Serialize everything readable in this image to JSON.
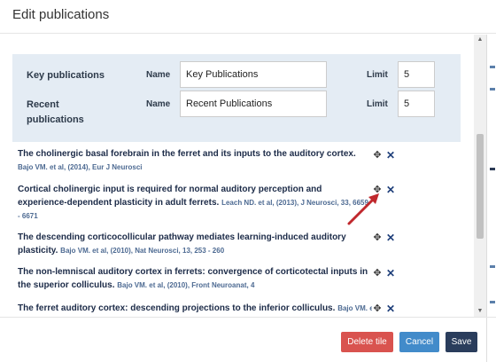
{
  "header": {
    "title": "Edit publications"
  },
  "settings": {
    "rows": [
      {
        "label": "Key publications",
        "name_label": "Name",
        "name_value": "Key Publications",
        "limit_label": "Limit",
        "limit_value": "5"
      },
      {
        "label_line1": "Recent",
        "label_line2": "publications",
        "name_label": "Name",
        "name_value": "Recent Publications",
        "limit_label": "Limit",
        "limit_value": "5"
      }
    ]
  },
  "publications": [
    {
      "title": "The cholinergic basal forebrain in the ferret and its inputs to the auditory cortex.",
      "meta": "Bajo VM. et al, (2014), Eur J Neurosci"
    },
    {
      "title": "Cortical cholinergic input is required for normal auditory perception and experience-dependent plasticity in adult ferrets.",
      "meta": "Leach ND. et al, (2013), J Neurosci, 33, 6659 - 6671"
    },
    {
      "title": "The descending corticocollicular pathway mediates learning-induced auditory plasticity.",
      "meta": "Bajo VM. et al, (2010), Nat Neurosci, 13, 253 - 260"
    },
    {
      "title": "The non-lemniscal auditory cortex in ferrets: convergence of corticotectal inputs in the superior colliculus.",
      "meta": "Bajo VM. et al, (2010), Front Neuroanat, 4"
    },
    {
      "title": "The ferret auditory cortex: descending projections to the inferior colliculus.",
      "meta": "Bajo VM. et al"
    }
  ],
  "icons": {
    "move": "move-icon",
    "delete": "delete-icon",
    "annotation": "red-arrow"
  },
  "footer": {
    "delete_label": "Delete tile",
    "cancel_label": "Cancel",
    "save_label": "Save"
  },
  "colors": {
    "panel": "#e4ecf4",
    "delete": "#d9534f",
    "cancel": "#428bca",
    "save": "#2a3d5c",
    "arrow": "#c0282d"
  }
}
